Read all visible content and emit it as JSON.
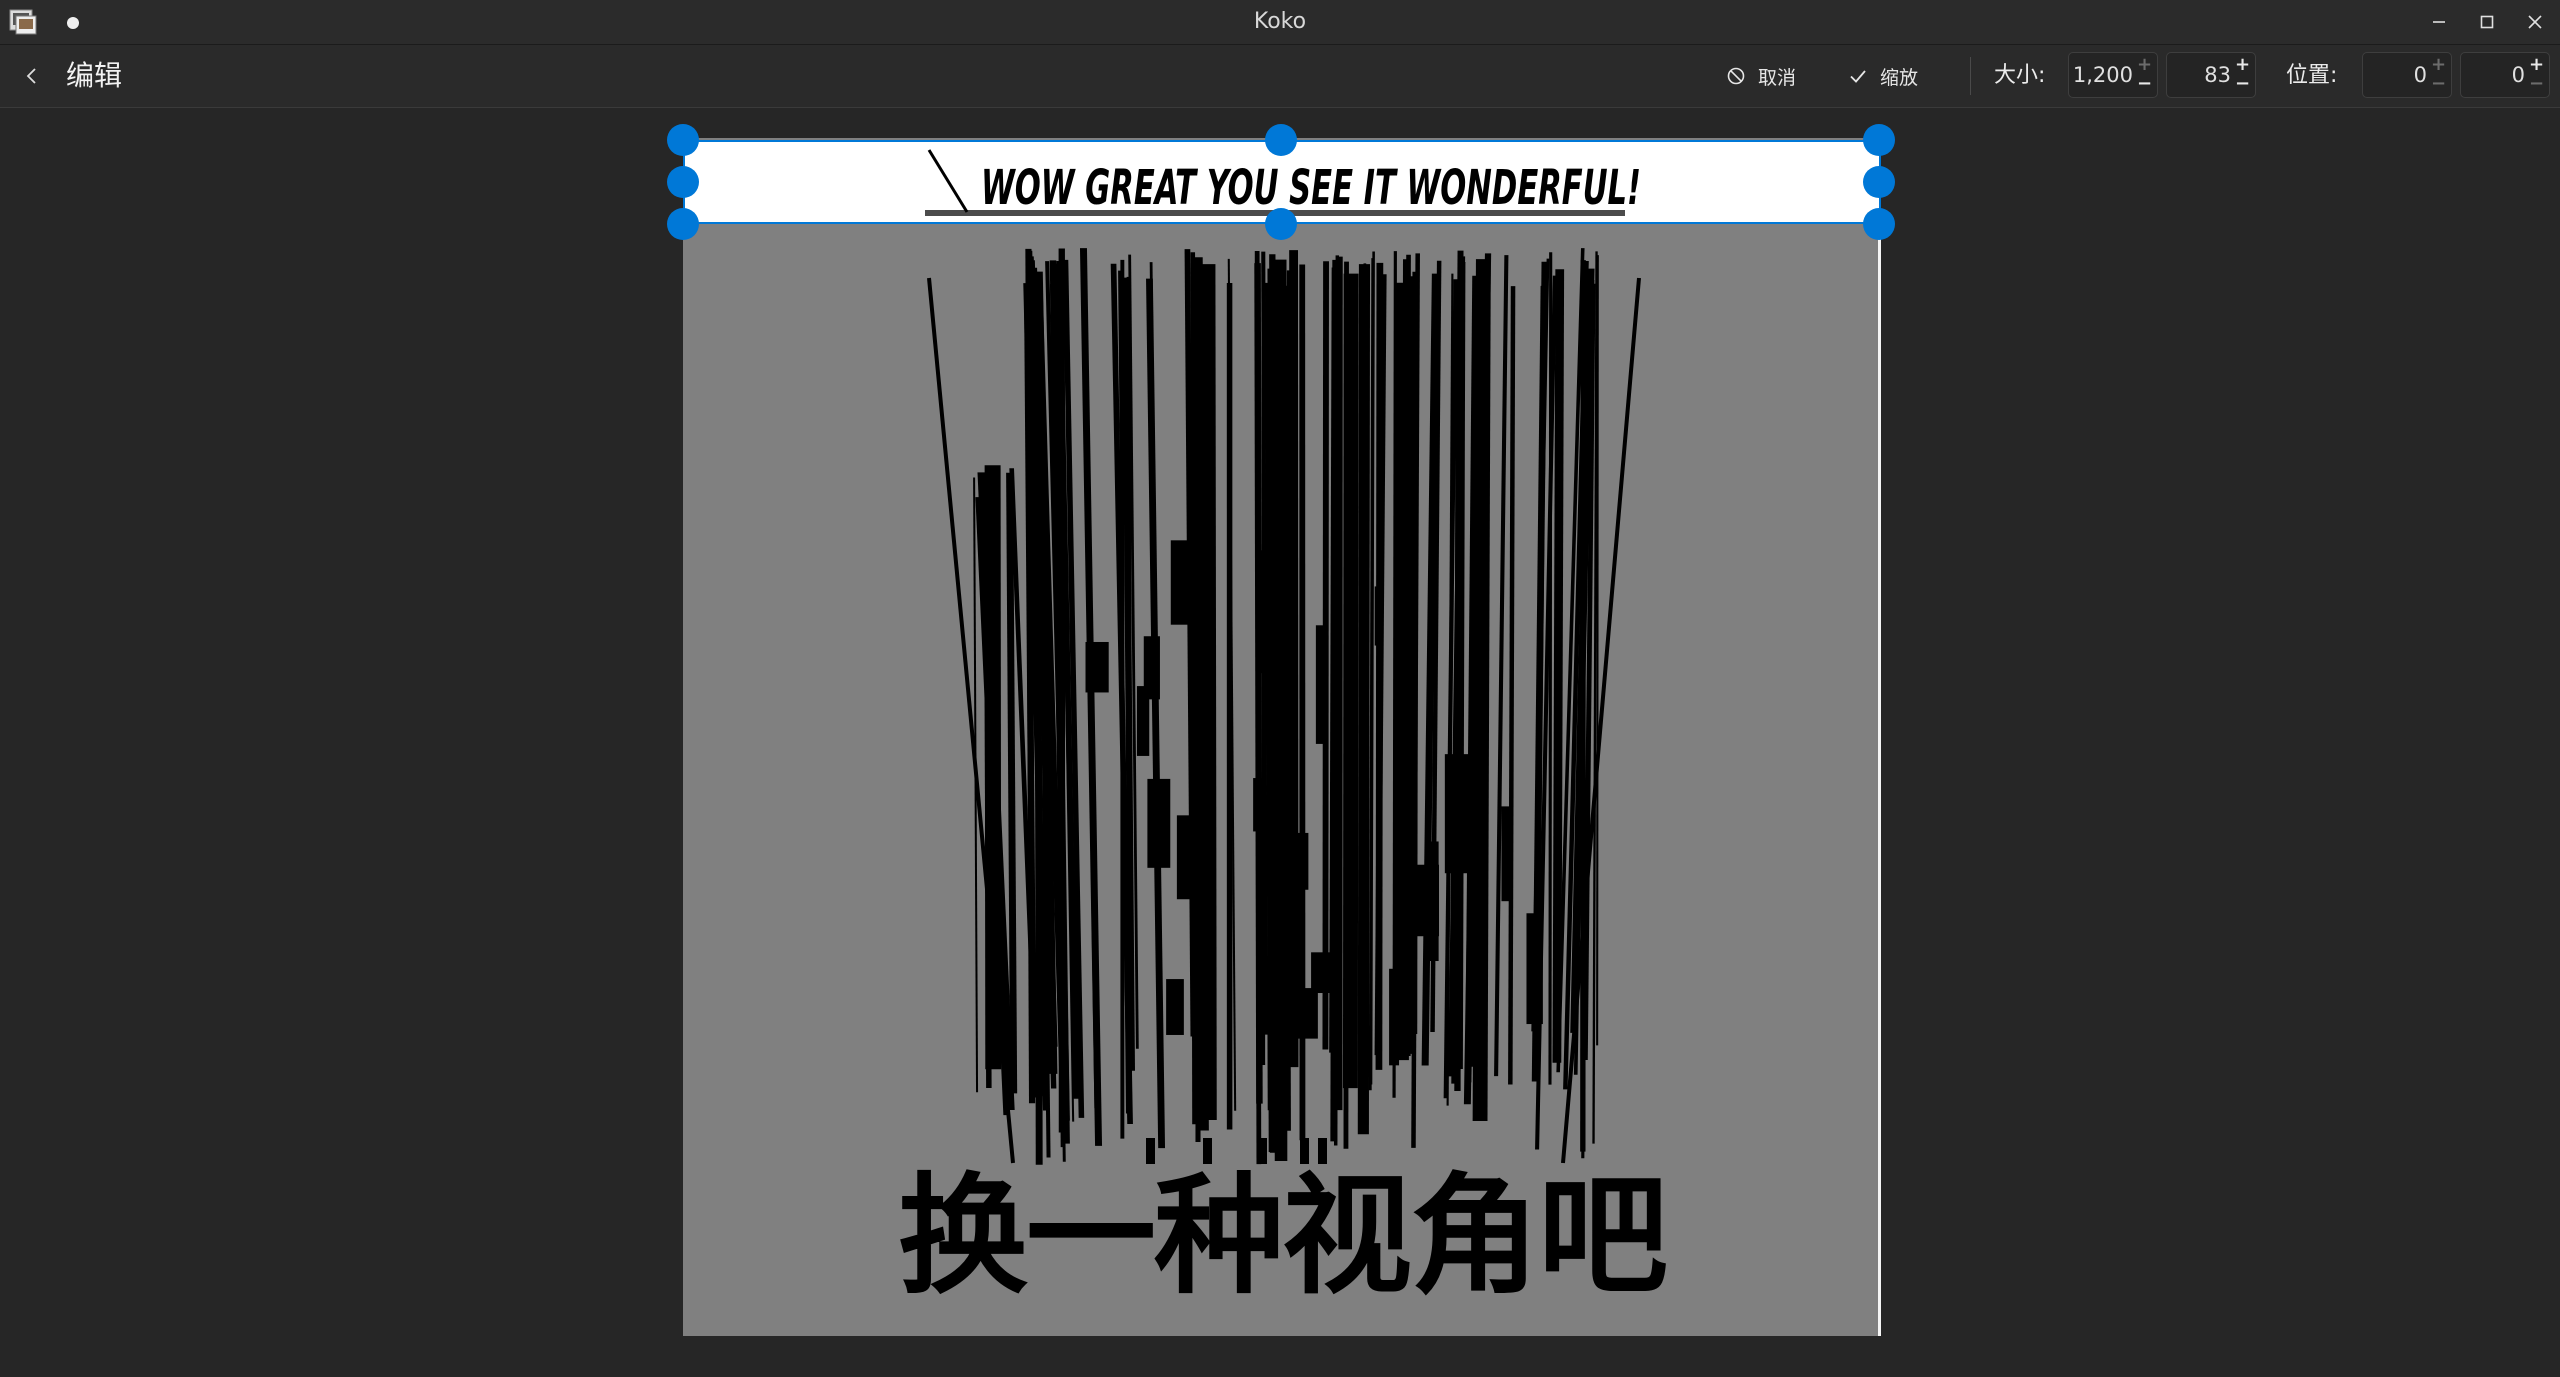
{
  "window": {
    "title": "Koko"
  },
  "toolbar": {
    "back_icon": "chevron-left-icon",
    "title": "编辑",
    "cancel_label": "取消",
    "cancel_icon": "cancel-icon",
    "scale_label": "缩放",
    "scale_icon": "checkmark-icon",
    "size_label": "大小:",
    "width_value": "1,200",
    "height_value": "83",
    "position_label": "位置:",
    "x_value": "0",
    "y_value": "0"
  },
  "image": {
    "strip_text": "WOW GREAT YOU SEE IT WONDERFUL!",
    "caption": "换一种视角吧"
  },
  "colors": {
    "accent": "#0078d7",
    "image_background": "#808080"
  }
}
